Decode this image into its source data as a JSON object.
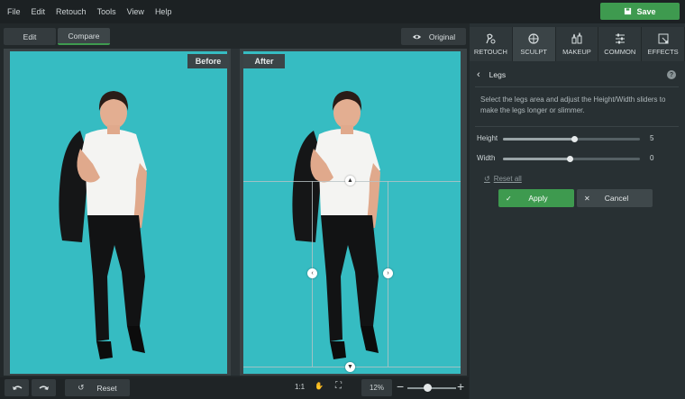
{
  "menu": [
    "File",
    "Edit",
    "Retouch",
    "Tools",
    "View",
    "Help"
  ],
  "save_label": "Save",
  "view_tabs": {
    "edit": "Edit",
    "compare": "Compare"
  },
  "original_label": "Original",
  "canvas": {
    "before_label": "Before",
    "after_label": "After",
    "background_color": "#36bcc2"
  },
  "bottom": {
    "reset_label": "Reset",
    "one_to_one": "1:1",
    "zoom": "12%"
  },
  "panel": {
    "tabs": [
      {
        "label": "RETOUCH",
        "icon": "retouch-icon"
      },
      {
        "label": "SCULPT",
        "icon": "sculpt-icon",
        "active": true
      },
      {
        "label": "MAKEUP",
        "icon": "makeup-icon"
      },
      {
        "label": "COMMON",
        "icon": "sliders-icon"
      },
      {
        "label": "EFFECTS",
        "icon": "effects-icon"
      }
    ],
    "title": "Legs",
    "description": "Select the legs area and adjust the Height/Width sliders to make the legs longer or slimmer.",
    "sliders": [
      {
        "label": "Height",
        "value": "5",
        "fraction": 0.52
      },
      {
        "label": "Width",
        "value": "0",
        "fraction": 0.49
      }
    ],
    "reset_all": "Reset all",
    "apply": "Apply",
    "cancel": "Cancel"
  },
  "colors": {
    "accent": "#3e9a4f",
    "panel": "#283033"
  }
}
